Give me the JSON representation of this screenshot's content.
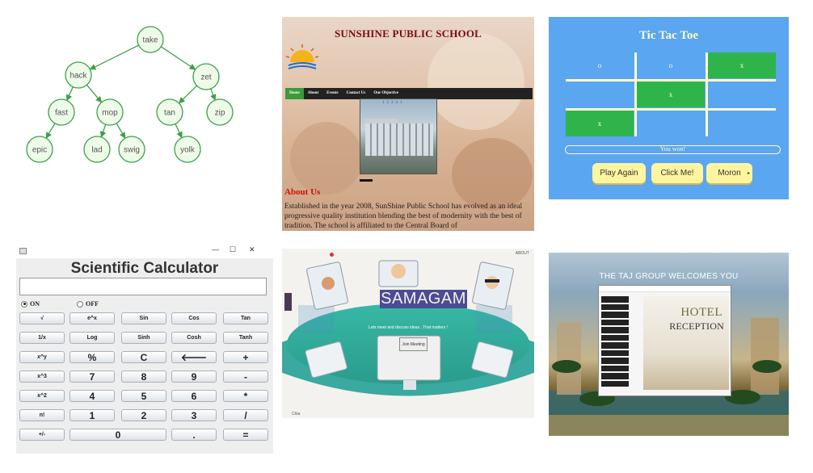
{
  "tree": {
    "nodes": [
      "take",
      "hack",
      "zet",
      "fast",
      "mop",
      "tan",
      "zip",
      "epic",
      "lad",
      "swig",
      "yolk"
    ]
  },
  "school": {
    "title": "SUNSHINE PUBLIC SCHOOL",
    "nav": [
      "Home",
      "About",
      "Events",
      "Contact Us",
      "Our Objective"
    ],
    "pager": [
      "1",
      "2",
      "3",
      "4",
      "1"
    ],
    "about_heading": "About Us",
    "about_text": "Established in the year 2008, SunShine Public School has evolved as an ideal progressive quality institution blending the best of modernity with the best of tradition. The school is affiliated to the Central Board of"
  },
  "ttt": {
    "title": "Tic Tac Toe",
    "cells": [
      "o",
      "o",
      "x",
      "",
      "x",
      "",
      "x",
      "",
      ""
    ],
    "status": "You won!",
    "buttons": [
      "Play Again",
      "Click Me!",
      "Moron"
    ]
  },
  "calc": {
    "title": "Scientific Calculator",
    "radio_on": "ON",
    "radio_off": "OFF",
    "win_min": "—",
    "win_max": "☐",
    "win_close": "✕",
    "keys": [
      [
        "√",
        "e^x",
        "Sin",
        "Cos",
        "Tan"
      ],
      [
        "1/x",
        "Log",
        "Sinh",
        "Cosh",
        "Tanh"
      ],
      [
        "x^y",
        "%",
        "C",
        "🡐",
        "+"
      ],
      [
        "x^3",
        "7",
        "8",
        "9",
        "-"
      ],
      [
        "x^2",
        "4",
        "5",
        "6",
        "*"
      ],
      [
        "n!",
        "1",
        "2",
        "3",
        "/"
      ],
      [
        "+/-",
        "0",
        ".",
        "="
      ]
    ]
  },
  "samagam": {
    "logo": "SAMAGAM",
    "about": "ABOUT",
    "tagline": "Lets meet and discuss ideas , That matters !",
    "join": "Join Meeting",
    "footer": "Chia"
  },
  "hotel": {
    "welcome": "THE TAJ GROUP WELCOMES YOU",
    "rec_line1": "HOTEL",
    "rec_line2": "RECEPTION"
  }
}
